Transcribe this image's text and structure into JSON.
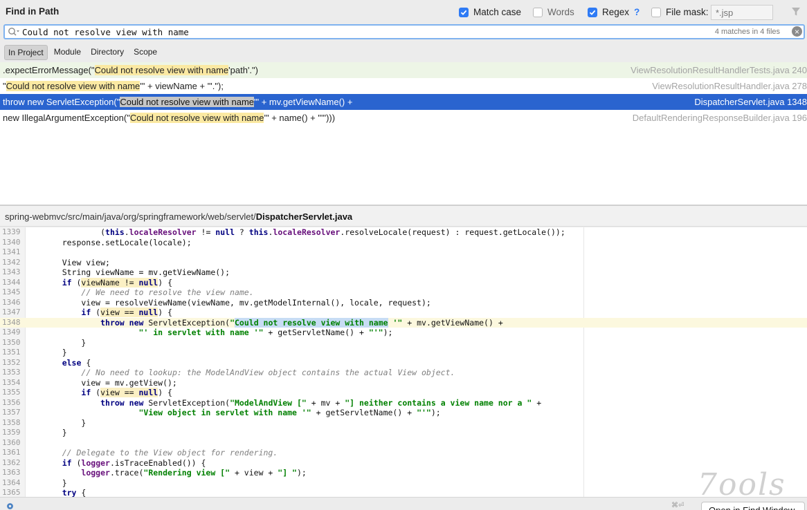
{
  "header": {
    "title": "Find in Path",
    "match_case_label": "Match case",
    "words_label": "Words",
    "regex_label": "Regex",
    "regex_help": "?",
    "file_mask_label": "File mask:",
    "file_mask_placeholder": "*.jsp"
  },
  "search": {
    "query": "Could not resolve view with name",
    "match_count": "4 matches in 4 files",
    "clear_icon": "×"
  },
  "tabs": [
    {
      "label": "In Project",
      "active": true
    },
    {
      "label": "Module"
    },
    {
      "label": "Directory"
    },
    {
      "label": "Scope"
    }
  ],
  "results": [
    {
      "prefix": ".expectErrorMessage(\"",
      "match": "Could not resolve view with name",
      "suffix": " 'path'.\")",
      "file": "ViewResolutionResultHandlerTests.java 240"
    },
    {
      "prefix": "\"",
      "match": "Could not resolve view with name",
      "suffix": " '\" + viewName + \"'.\");",
      "file": "ViewResolutionResultHandler.java 278"
    },
    {
      "prefix": "throw new ServletException(\"",
      "match": "Could not resolve view with name",
      "suffix": " '\" + mv.getViewName() +",
      "file": "DispatcherServlet.java 1348"
    },
    {
      "prefix": "new IllegalArgumentException(\"",
      "match": "Could not resolve view with name",
      "suffix": " '\" + name() + \"'\")))",
      "file": "DefaultRenderingResponseBuilder.java 196"
    }
  ],
  "path": {
    "dir": "spring-webmvc/src/main/java/org/springframework/web/servlet/",
    "file": "DispatcherServlet.java"
  },
  "code": [
    {
      "n": "1339",
      "t": "            (this.localeResolver != null ? this.localeResolver.resolveLocale(request) : request.getLocale());"
    },
    {
      "n": "1340",
      "t": "    response.setLocale(locale);"
    },
    {
      "n": "1341",
      "t": ""
    },
    {
      "n": "1342",
      "t": "    View view;"
    },
    {
      "n": "1343",
      "t": "    String viewName = mv.getViewName();"
    },
    {
      "n": "1344",
      "t": "    if (viewName != null) {"
    },
    {
      "n": "1345",
      "t": "        // We need to resolve the view name."
    },
    {
      "n": "1346",
      "t": "        view = resolveViewName(viewName, mv.getModelInternal(), locale, request);"
    },
    {
      "n": "1347",
      "t": "        if (view == null) {"
    },
    {
      "n": "1348",
      "t": "            throw new ServletException(\"Could not resolve view with name '\" + mv.getViewName() +"
    },
    {
      "n": "1349",
      "t": "                    \"' in servlet with name '\" + getServletName() + \"'\");"
    },
    {
      "n": "1350",
      "t": "        }"
    },
    {
      "n": "1351",
      "t": "    }"
    },
    {
      "n": "1352",
      "t": "    else {"
    },
    {
      "n": "1353",
      "t": "        // No need to lookup: the ModelAndView object contains the actual View object."
    },
    {
      "n": "1354",
      "t": "        view = mv.getView();"
    },
    {
      "n": "1355",
      "t": "        if (view == null) {"
    },
    {
      "n": "1356",
      "t": "            throw new ServletException(\"ModelAndView [\" + mv + \"] neither contains a view name nor a \" +"
    },
    {
      "n": "1357",
      "t": "                    \"View object in servlet with name '\" + getServletName() + \"'\");"
    },
    {
      "n": "1358",
      "t": "        }"
    },
    {
      "n": "1359",
      "t": "    }"
    },
    {
      "n": "1360",
      "t": ""
    },
    {
      "n": "1361",
      "t": "    // Delegate to the View object for rendering."
    },
    {
      "n": "1362",
      "t": "    if (logger.isTraceEnabled()) {"
    },
    {
      "n": "1363",
      "t": "        logger.trace(\"Rendering view [\" + view + \"] \");"
    },
    {
      "n": "1364",
      "t": "    }"
    },
    {
      "n": "1365",
      "t": "    try {"
    }
  ],
  "bottom": {
    "shortcut": "⌘⏎",
    "open_button": "Open in Find Window",
    "watermark": "7ools"
  },
  "colors": {
    "accent": "#2f7bf5",
    "selection": "#2a64cf",
    "match_highlight": "#fbe9a2"
  }
}
